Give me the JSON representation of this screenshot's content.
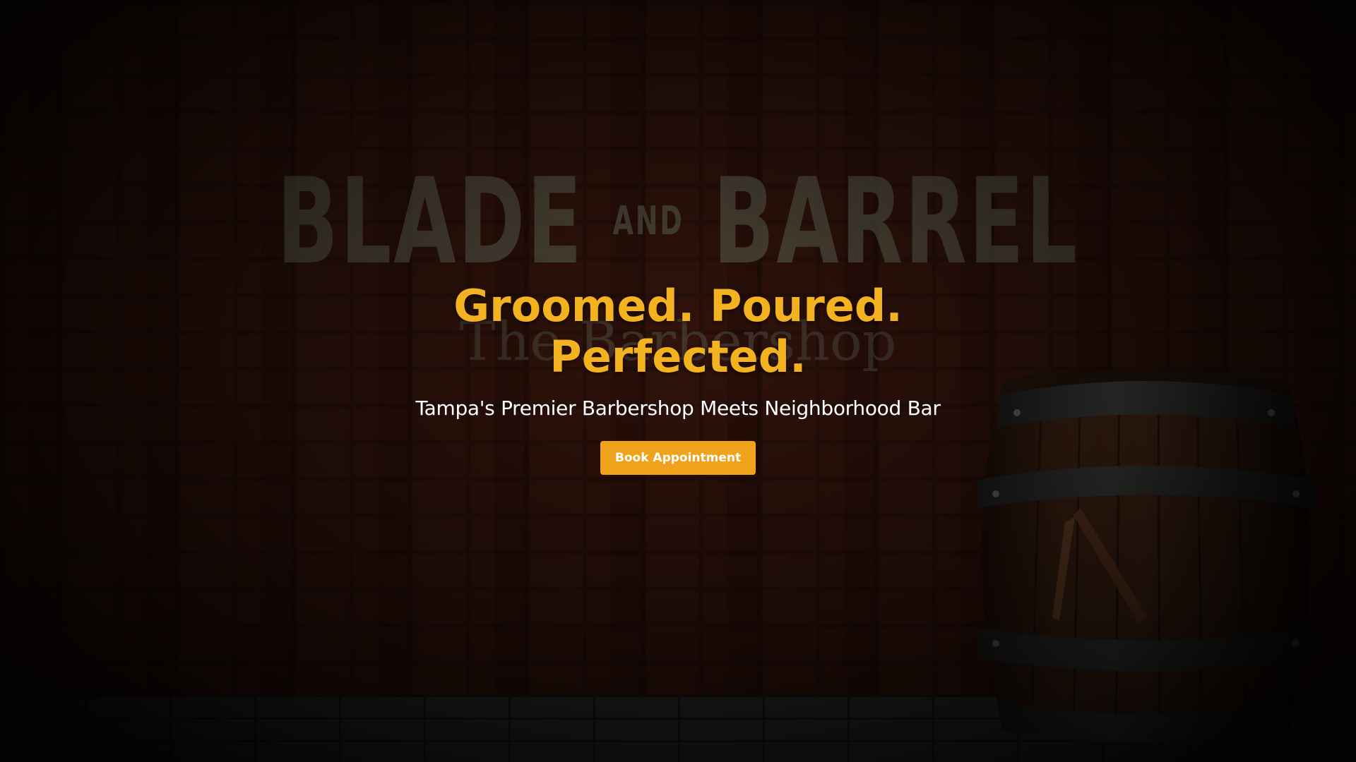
{
  "sign": {
    "word1": "BLADE",
    "word2": "AND",
    "word3": "BARREL",
    "line2": "The Barbershop"
  },
  "hero": {
    "headline": "Groomed. Poured. Perfected.",
    "subheadline": "Tampa's Premier Barbershop Meets Neighborhood Bar",
    "cta_label": "Book Appointment"
  },
  "colors": {
    "accent": "#f3b21f",
    "button": "#f0a21a",
    "background": "#0b0806"
  },
  "icons": {
    "barrel": "barrel-with-razor-icon"
  }
}
